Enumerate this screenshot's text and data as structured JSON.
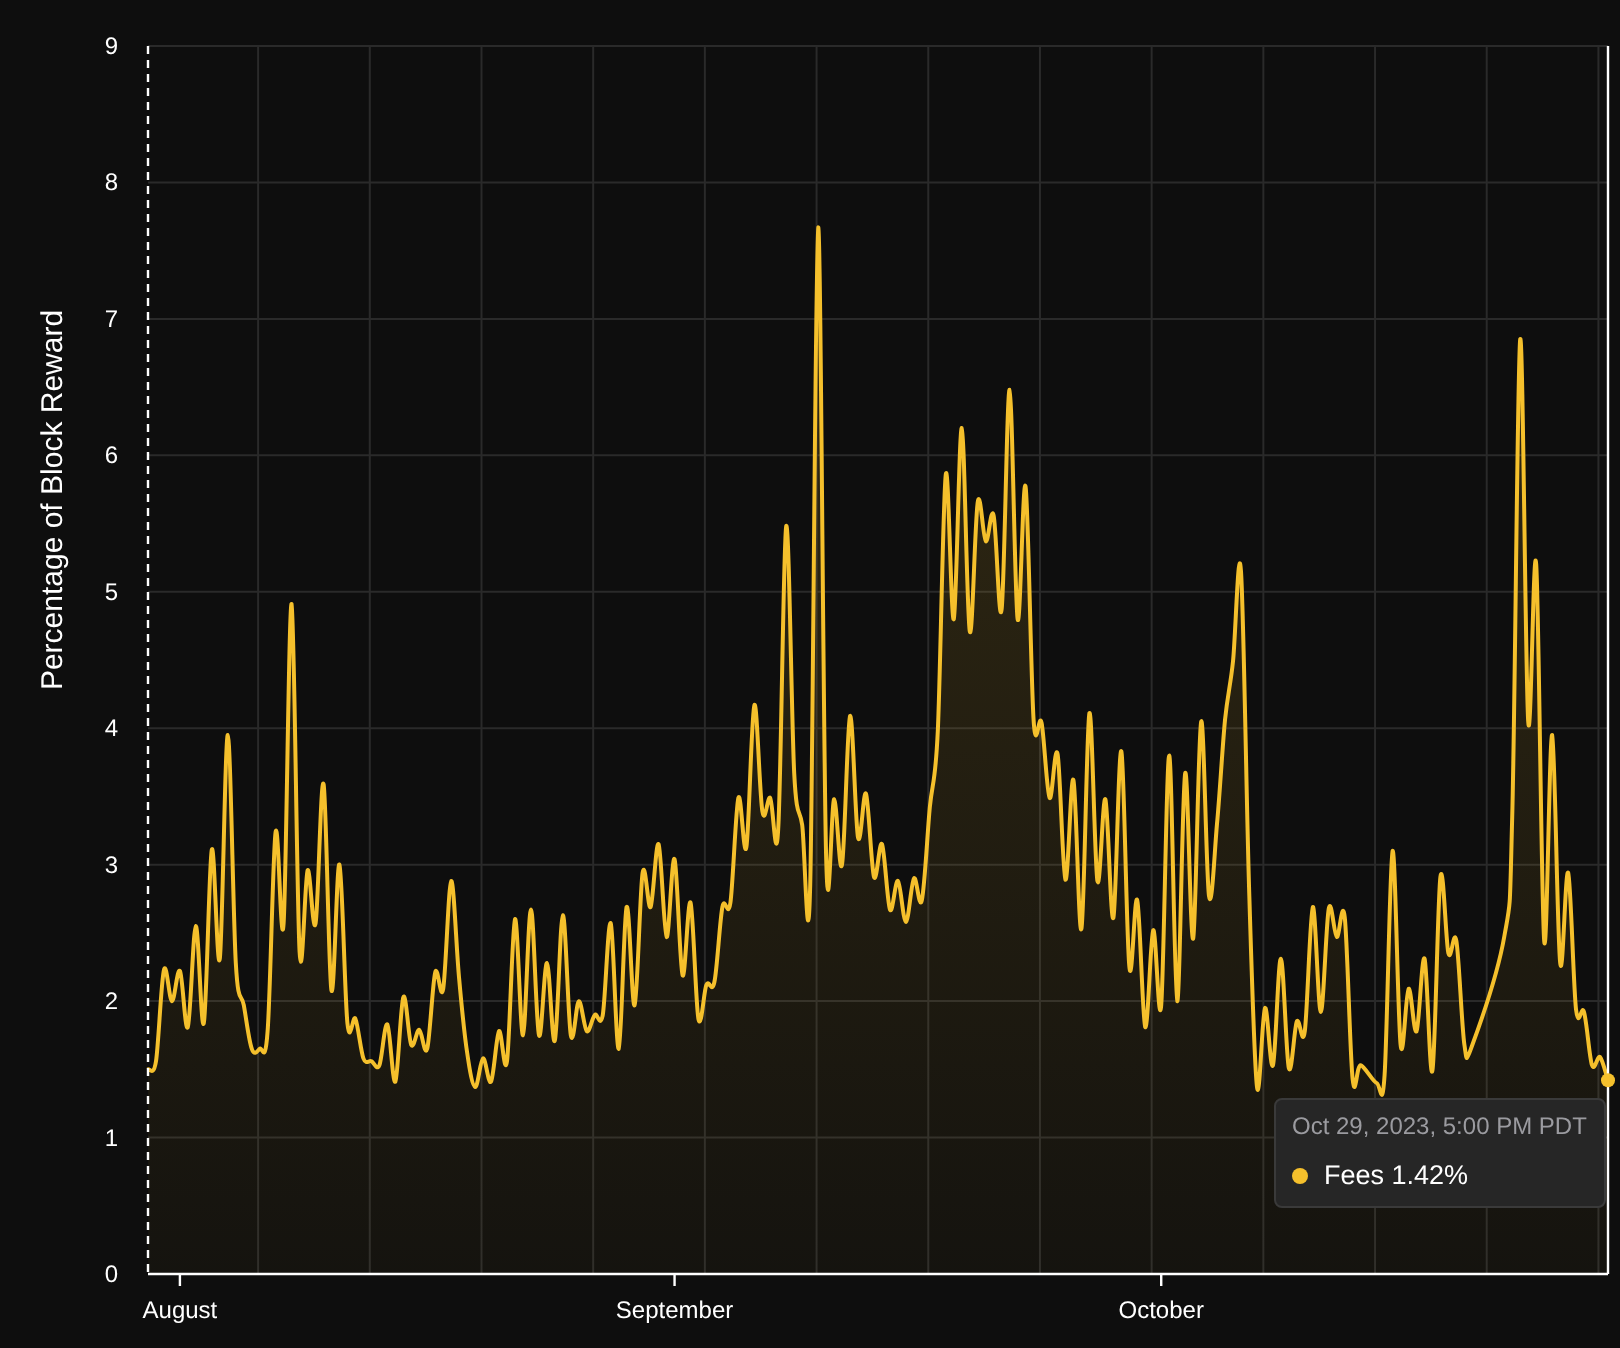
{
  "chart": {
    "chart_data": {
      "type": "area",
      "ylabel": "Percentage of Block Reward",
      "categories": [
        null,
        null,
        null,
        null,
        "August",
        null,
        null,
        null,
        null,
        null,
        null,
        null,
        null,
        null,
        null,
        null,
        null,
        null,
        null,
        null,
        null,
        null,
        null,
        null,
        null,
        null,
        null,
        null,
        null,
        null,
        null,
        null,
        null,
        null,
        null,
        null,
        null,
        null,
        null,
        null,
        null,
        null,
        null,
        null,
        null,
        null,
        null,
        null,
        null,
        null,
        null,
        null,
        null,
        null,
        null,
        null,
        null,
        null,
        null,
        null,
        null,
        null,
        null,
        null,
        null,
        null,
        "September",
        null,
        null,
        null,
        null,
        null,
        null,
        null,
        null,
        null,
        null,
        null,
        null,
        null,
        null,
        null,
        null,
        null,
        null,
        null,
        null,
        null,
        null,
        null,
        null,
        null,
        null,
        null,
        null,
        null,
        null,
        null,
        null,
        null,
        null,
        null,
        null,
        null,
        null,
        null,
        null,
        null,
        null,
        null,
        null,
        null,
        null,
        null,
        null,
        null,
        null,
        null,
        null,
        null,
        null,
        null,
        null,
        null,
        null,
        null,
        null,
        "October",
        null,
        null,
        null,
        null,
        null,
        null,
        null,
        null,
        null,
        null,
        null,
        null,
        null,
        null,
        null,
        null,
        null,
        null,
        null,
        null,
        null,
        null,
        null,
        null,
        null,
        null,
        null,
        null,
        null,
        null,
        null,
        null,
        null,
        null,
        null,
        null,
        null,
        null,
        null,
        null,
        null,
        null,
        null,
        null,
        null,
        null,
        null,
        null,
        null,
        null,
        null,
        null,
        null,
        null,
        null,
        null
      ],
      "series": [
        {
          "name": "Fees",
          "color": "#f5c02c",
          "values": [
            1.5,
            1.56,
            2.23,
            2.0,
            2.22,
            1.81,
            2.55,
            1.84,
            3.11,
            2.31,
            3.95,
            2.28,
            1.97,
            1.65,
            1.65,
            1.78,
            3.24,
            2.57,
            4.91,
            2.36,
            2.96,
            2.57,
            3.59,
            2.08,
            3.0,
            1.84,
            1.87,
            1.58,
            1.56,
            1.53,
            1.83,
            1.41,
            2.03,
            1.68,
            1.79,
            1.65,
            2.21,
            2.09,
            2.88,
            2.16,
            1.62,
            1.37,
            1.58,
            1.41,
            1.78,
            1.56,
            2.6,
            1.75,
            2.67,
            1.75,
            2.28,
            1.71,
            2.63,
            1.75,
            2.0,
            1.78,
            1.9,
            1.9,
            2.57,
            1.65,
            2.69,
            1.97,
            2.94,
            2.69,
            3.15,
            2.47,
            3.04,
            2.19,
            2.72,
            1.87,
            2.12,
            2.14,
            2.69,
            2.72,
            3.49,
            3.13,
            4.17,
            3.39,
            3.49,
            3.26,
            5.48,
            3.67,
            3.29,
            2.85,
            7.67,
            3.04,
            3.48,
            3.0,
            4.09,
            3.2,
            3.52,
            2.91,
            3.15,
            2.67,
            2.88,
            2.58,
            2.9,
            2.74,
            3.42,
            3.98,
            5.86,
            4.8,
            6.2,
            4.71,
            5.66,
            5.37,
            5.56,
            4.87,
            6.48,
            4.8,
            5.77,
            4.06,
            4.04,
            3.49,
            3.81,
            2.89,
            3.62,
            2.53,
            4.11,
            2.88,
            3.48,
            2.61,
            3.83,
            2.25,
            2.74,
            1.81,
            2.52,
            1.97,
            3.8,
            2.0,
            3.67,
            2.46,
            4.05,
            2.77,
            3.3,
            4.06,
            4.49,
            5.15,
            2.85,
            1.37,
            1.95,
            1.53,
            2.31,
            1.51,
            1.85,
            1.78,
            2.69,
            1.92,
            2.68,
            2.47,
            2.61,
            1.43,
            1.53,
            null,
            1.4,
            1.46,
            3.1,
            1.68,
            2.09,
            1.78,
            2.31,
            1.49,
            2.91,
            2.35,
            2.44,
            1.68,
            1.68,
            null,
            null,
            null,
            2.47,
            3.35,
            6.85,
            4.05,
            5.2,
            2.44,
            3.95,
            2.28,
            2.94,
            1.94,
            1.92,
            1.53,
            1.59,
            1.42
          ]
        }
      ],
      "grid": true,
      "ylim": [
        0,
        9
      ],
      "yticks": [
        0,
        1,
        2,
        3,
        4,
        5,
        6,
        7,
        8,
        9
      ]
    }
  },
  "tooltip": {
    "title": "Oct 29, 2023, 5:00 PM PDT",
    "items": [
      {
        "value": "1.42%"
      }
    ]
  }
}
